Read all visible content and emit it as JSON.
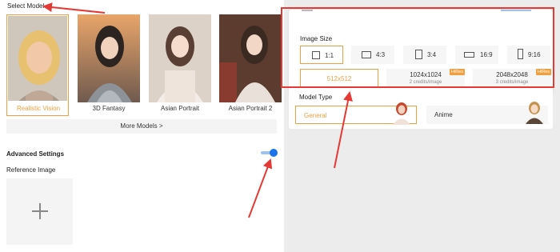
{
  "left": {
    "select_model_label": "Select Model",
    "models": [
      {
        "name": "Realistic Vision",
        "selected": true
      },
      {
        "name": "3D Fantasy",
        "selected": false
      },
      {
        "name": "Asian Portrait",
        "selected": false
      },
      {
        "name": "Asian Portrait 2",
        "selected": false
      }
    ],
    "more_models_label": "More Models >",
    "advanced_settings_label": "Advanced Settings",
    "advanced_settings_enabled": true,
    "reference_image_label": "Reference Image"
  },
  "right": {
    "image_size_label": "Image Size",
    "ratios": [
      {
        "label": "1:1",
        "selected": true
      },
      {
        "label": "4:3",
        "selected": false
      },
      {
        "label": "3:4",
        "selected": false
      },
      {
        "label": "16:9",
        "selected": false
      },
      {
        "label": "9:16",
        "selected": false
      }
    ],
    "resolutions": [
      {
        "label": "512x512",
        "sub": "",
        "badge": "",
        "selected": true
      },
      {
        "label": "1024x1024",
        "sub": "2 credits/image",
        "badge": "HiRes",
        "selected": false
      },
      {
        "label": "2048x2048",
        "sub": "3 credits/image",
        "badge": "HiRes",
        "selected": false
      }
    ],
    "model_type_label": "Model Type",
    "model_types": [
      {
        "label": "General",
        "selected": true
      },
      {
        "label": "Anime",
        "selected": false
      }
    ]
  },
  "colors": {
    "accent": "#f0a040",
    "toggle": "#1a73e8",
    "annotation": "#e53935"
  },
  "icons": {
    "plus": "plus-icon",
    "arrow": "annotation-arrow"
  }
}
